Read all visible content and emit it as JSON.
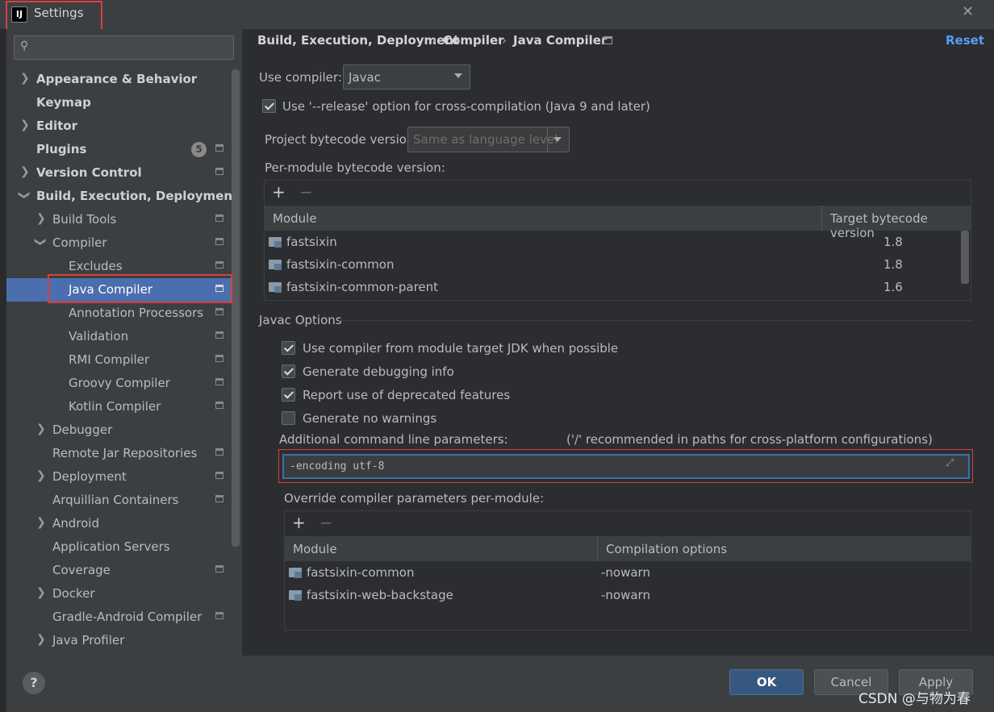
{
  "window": {
    "title": "Settings",
    "logo": "IJ"
  },
  "search": {
    "placeholder": ""
  },
  "sidebar": {
    "items": [
      {
        "label": "Appearance & Behavior"
      },
      {
        "label": "Keymap"
      },
      {
        "label": "Editor"
      },
      {
        "label": "Plugins",
        "badge": "5"
      },
      {
        "label": "Version Control"
      },
      {
        "label": "Build, Execution, Deployment"
      },
      {
        "label": "Build Tools"
      },
      {
        "label": "Compiler"
      },
      {
        "label": "Excludes"
      },
      {
        "label": "Java Compiler"
      },
      {
        "label": "Annotation Processors"
      },
      {
        "label": "Validation"
      },
      {
        "label": "RMI Compiler"
      },
      {
        "label": "Groovy Compiler"
      },
      {
        "label": "Kotlin Compiler"
      },
      {
        "label": "Debugger"
      },
      {
        "label": "Remote Jar Repositories"
      },
      {
        "label": "Deployment"
      },
      {
        "label": "Arquillian Containers"
      },
      {
        "label": "Android"
      },
      {
        "label": "Application Servers"
      },
      {
        "label": "Coverage"
      },
      {
        "label": "Docker"
      },
      {
        "label": "Gradle-Android Compiler"
      },
      {
        "label": "Java Profiler"
      }
    ]
  },
  "breadcrumb": {
    "part1": "Build, Execution, Deployment",
    "part2": "Compiler",
    "part3": "Java Compiler",
    "sep": "›"
  },
  "reset_label": "Reset",
  "compiler": {
    "label": "Use compiler:",
    "value": "Javac"
  },
  "release_option": {
    "label": "Use '--release' option for cross-compilation (Java 9 and later)",
    "checked": true
  },
  "bytecode": {
    "label": "Project bytecode version:",
    "placeholder": "Same as language level"
  },
  "per_module": {
    "label": "Per-module bytecode version:",
    "columns": [
      "Module",
      "Target bytecode version"
    ],
    "rows": [
      {
        "module": "fastsixin",
        "version": "1.8"
      },
      {
        "module": "fastsixin-common",
        "version": "1.8"
      },
      {
        "module": "fastsixin-common-parent",
        "version": "1.6"
      }
    ]
  },
  "javac_options": {
    "title": "Javac Options",
    "checkboxes": [
      {
        "label": "Use compiler from module target JDK when possible",
        "checked": true
      },
      {
        "label": "Generate debugging info",
        "checked": true
      },
      {
        "label": "Report use of deprecated features",
        "checked": true
      },
      {
        "label": "Generate no warnings",
        "checked": false
      }
    ],
    "additional_label": "Additional command line parameters:",
    "additional_hint": "('/' recommended in paths for cross-platform configurations)",
    "additional_value": "-encoding utf-8"
  },
  "override": {
    "label": "Override compiler parameters per-module:",
    "columns": [
      "Module",
      "Compilation options"
    ],
    "rows": [
      {
        "module": "fastsixin-common",
        "options": "-nowarn"
      },
      {
        "module": "fastsixin-web-backstage",
        "options": "-nowarn"
      }
    ]
  },
  "footer": {
    "help": "?",
    "ok": "OK",
    "cancel": "Cancel",
    "apply": "Apply"
  },
  "watermark": "CSDN @与物为春",
  "icons": {
    "plus": "+",
    "minus": "−",
    "chevron_right": "›",
    "chevron_down": "⌄"
  },
  "colors": {
    "selection": "#4b6eaf",
    "accent": "#589df6",
    "highlight_box": "#d94040"
  }
}
